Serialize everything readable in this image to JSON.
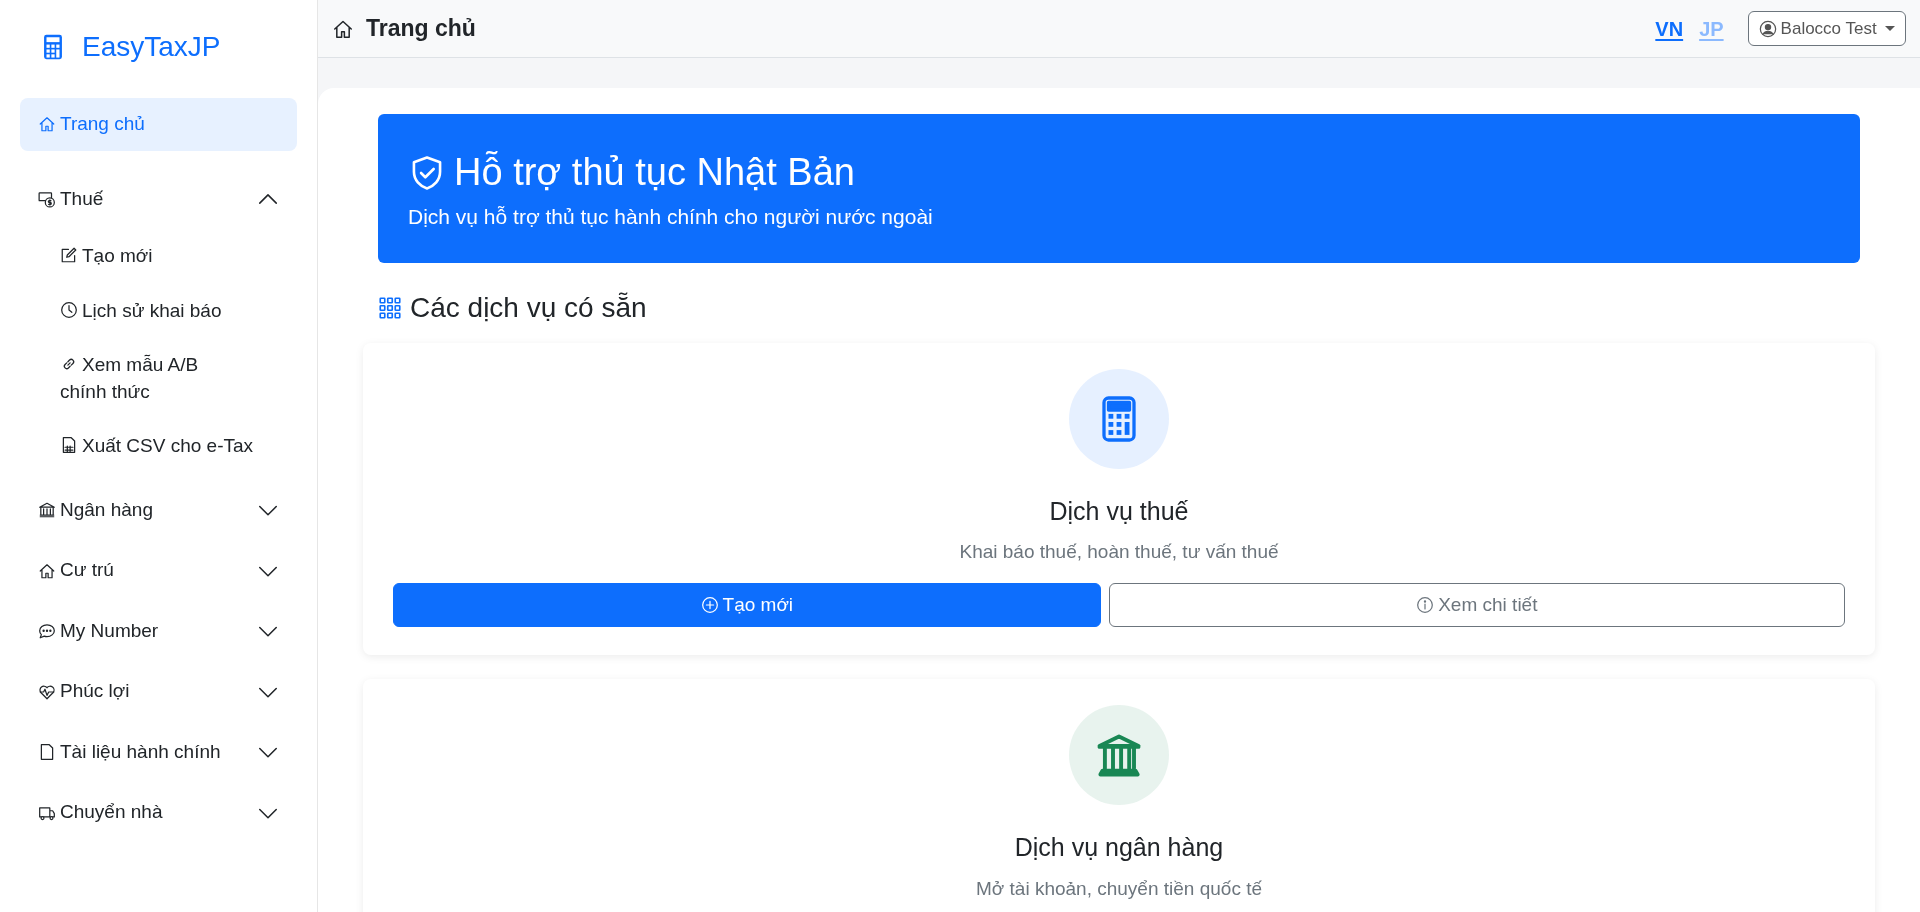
{
  "brand": {
    "name": "EasyTaxJP"
  },
  "sidebar": {
    "items": [
      {
        "kind": "link",
        "label": "Trang chủ",
        "selected": true
      },
      {
        "kind": "group",
        "label": "Thuế",
        "selected": false,
        "expanded": true,
        "children": [
          {
            "label": "Tạo mới"
          },
          {
            "label": "Lịch sử khai báo"
          },
          {
            "label": "Xem mẫu A/B chính thức"
          },
          {
            "label": "Xuất CSV cho e-Tax"
          }
        ]
      },
      {
        "kind": "group",
        "label": "Ngân hàng",
        "selected": false,
        "expanded": false
      },
      {
        "kind": "group",
        "label": "Cư trú",
        "selected": false,
        "expanded": false
      },
      {
        "kind": "group",
        "label": "My Number",
        "selected": false,
        "expanded": false
      },
      {
        "kind": "group",
        "label": "Phúc lợi",
        "selected": false,
        "expanded": false
      },
      {
        "kind": "group",
        "label": "Tài liệu hành chính",
        "selected": false,
        "expanded": false
      },
      {
        "kind": "group",
        "label": "Chuyển nhà",
        "selected": false,
        "expanded": false
      }
    ]
  },
  "header": {
    "title": "Trang chủ",
    "languages": [
      {
        "label": "VN",
        "selected": true
      },
      {
        "label": "JP",
        "selected": false
      }
    ],
    "user": "Balocco Test"
  },
  "banner": {
    "title": "Hỗ trợ thủ tục Nhật Bản",
    "subtitle": "Dịch vụ hỗ trợ thủ tục hành chính cho người nước ngoài"
  },
  "section_title": "Các dịch vụ có sẵn",
  "services": [
    {
      "title": "Dịch vụ thuế",
      "description": "Khai báo thuế, hoàn thuế, tư vấn thuế",
      "color": "#0d6efd",
      "buttons": [
        {
          "kind": "primary",
          "label": "Tạo mới"
        },
        {
          "kind": "outline",
          "label": "Xem chi tiết"
        }
      ]
    },
    {
      "title": "Dịch vụ ngân hàng",
      "description": "Mở tài khoản, chuyển tiền quốc tế",
      "color": "#198754"
    }
  ]
}
